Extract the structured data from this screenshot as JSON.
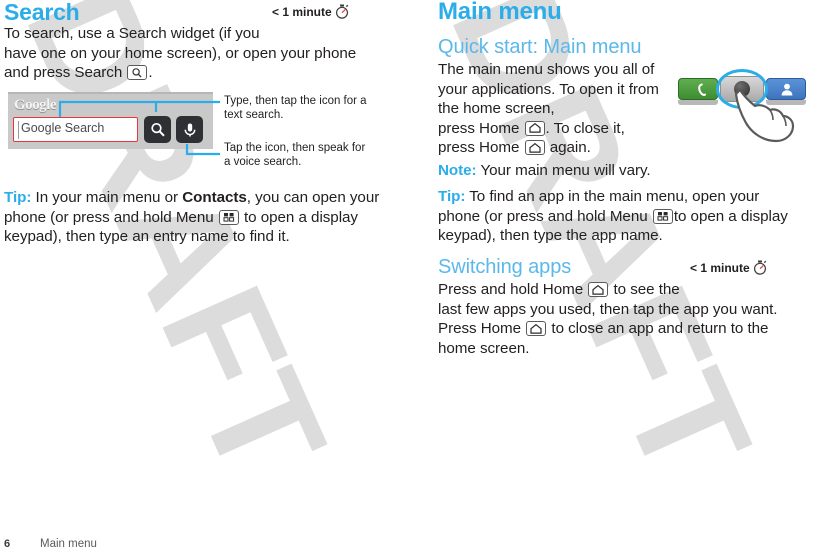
{
  "watermark": {
    "text": "DRAFT"
  },
  "left_column": {
    "heading": "Search",
    "time_badge": "< 1 minute",
    "intro_line1": "To search, use a Search widget (if you",
    "intro_line2": "have one on your home screen), or open your phone",
    "intro_line3_before": "and press Search",
    "intro_line3_after": ".",
    "figure": {
      "google_logo": "Google",
      "search_field_placeholder": "Google Search",
      "callout_text_search_line1": "Type, then tap the icon for a",
      "callout_text_search_line2": "text search.",
      "callout_voice_line1": "Tap the icon, then speak for",
      "callout_voice_line2": "a voice search."
    },
    "tip": {
      "label": "Tip:",
      "part1": " In your main menu or ",
      "bold": "Contacts",
      "part2": ", you can open your",
      "line2_before": "phone (or press and hold Menu",
      "line2_after": "to open a display",
      "line3": "keypad), then type an entry name to find it."
    }
  },
  "right_column": {
    "heading": "Main menu",
    "subheading": "Quick start: Main menu",
    "body_line1": "The main menu shows you all of",
    "body_line2": "your applications. To open it from",
    "body_line3": "the home screen,",
    "body_line4_before": "press Home",
    "body_line4_after": ". To close it,",
    "body_line5_before": "press Home",
    "body_line5_after": "again.",
    "note": {
      "label": "Note:",
      "text": " Your main menu will vary."
    },
    "tip": {
      "label": "Tip:",
      "part1": "  To find an app in the main menu, open your",
      "line2_before": "phone (or press and hold Menu",
      "line2_after": "to open a display",
      "line3": "keypad), then type the app name."
    },
    "switching": {
      "heading": "Switching apps",
      "time_badge": "< 1 minute",
      "line1_before": "Press and hold Home",
      "line1_after": "to see the",
      "line2": "last few apps you used, then tap the app you want.",
      "line3_before": "Press Home",
      "line3_after": "to close an app and return to the",
      "line4": "home screen."
    }
  },
  "icons": {
    "search_key": "search-icon",
    "menu_key": "menu-icon",
    "home_key": "home-icon",
    "stopwatch": "stopwatch-icon",
    "microphone": "microphone-icon",
    "call": "call-icon",
    "contacts": "contacts-icon",
    "hand": "hand-pointer-icon"
  },
  "footer": {
    "page_number": "6",
    "section_title": "Main menu"
  },
  "colors": {
    "heading_blue": "#2badea",
    "subheading_blue": "#5bb8ea",
    "accent_red": "#e8373a",
    "watermark_gray": "#dcdcdc",
    "call_green": "#4f9e40",
    "contacts_blue": "#4a82c9"
  }
}
